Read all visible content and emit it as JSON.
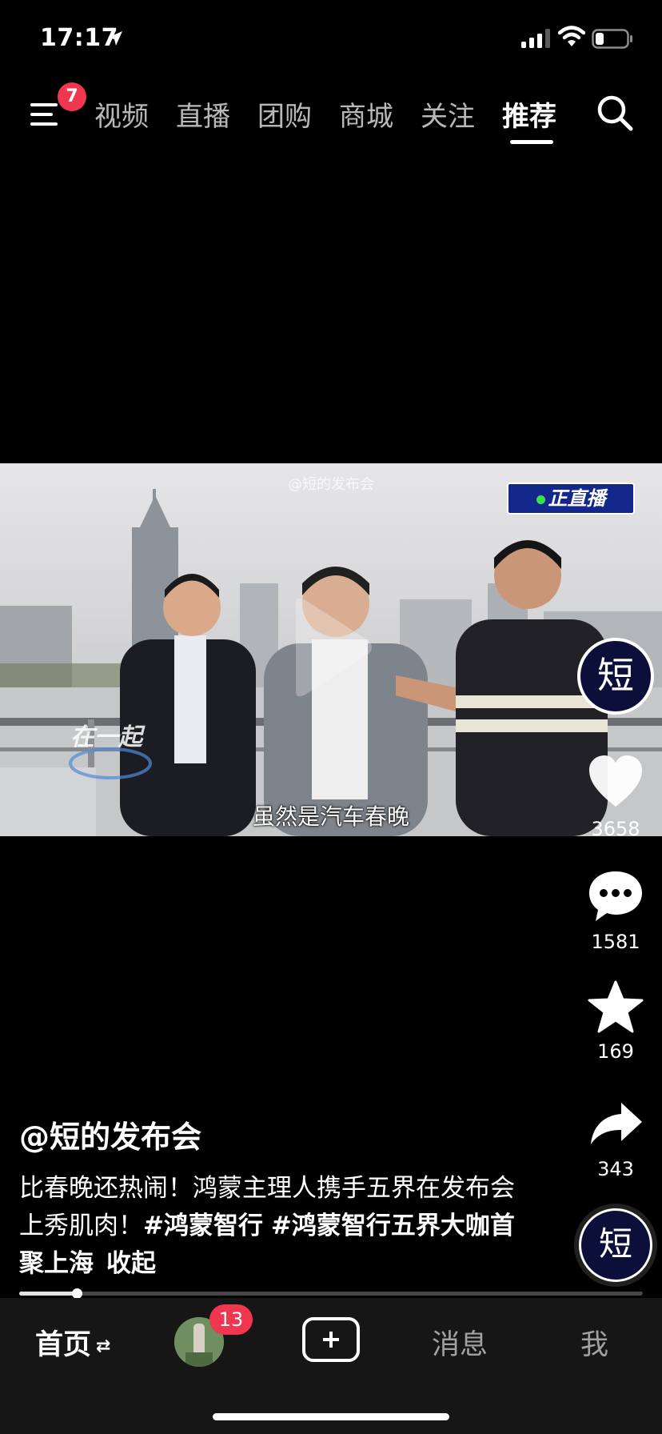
{
  "status_bar": {
    "time": "17:17"
  },
  "top_nav": {
    "menu_badge": "7",
    "tabs": [
      {
        "label": "视频"
      },
      {
        "label": "直播"
      },
      {
        "label": "团购"
      },
      {
        "label": "商城"
      },
      {
        "label": "关注"
      },
      {
        "label": "推荐",
        "active": true
      }
    ]
  },
  "video": {
    "watermark": "@短的发布会",
    "live_badge": "正直播",
    "subtitle": "虽然是汽车春晚",
    "logo_text": "在一起"
  },
  "rail": {
    "creator_avatar_text": "短",
    "like_count": "3658",
    "comment_count": "1581",
    "favorite_count": "169",
    "share_count": "343",
    "music_disc_text": "短"
  },
  "caption": {
    "author": "@短的发布会",
    "description_text": "比春晚还热闹！鸿蒙主理人携手五界在发布会上秀肌肉！",
    "hashtags": [
      "#鸿蒙智行",
      "#鸿蒙智行五界大咖首聚上海"
    ],
    "collapse_label": "收起"
  },
  "progress": {
    "fraction": 0.092
  },
  "bottom_tabs": {
    "home_label": "首页",
    "friends_badge": "13",
    "messages_label": "消息",
    "me_label": "我"
  },
  "colors": {
    "badge_red": "#f1374f",
    "live_blue": "#13288a",
    "live_green": "#3adf54"
  }
}
